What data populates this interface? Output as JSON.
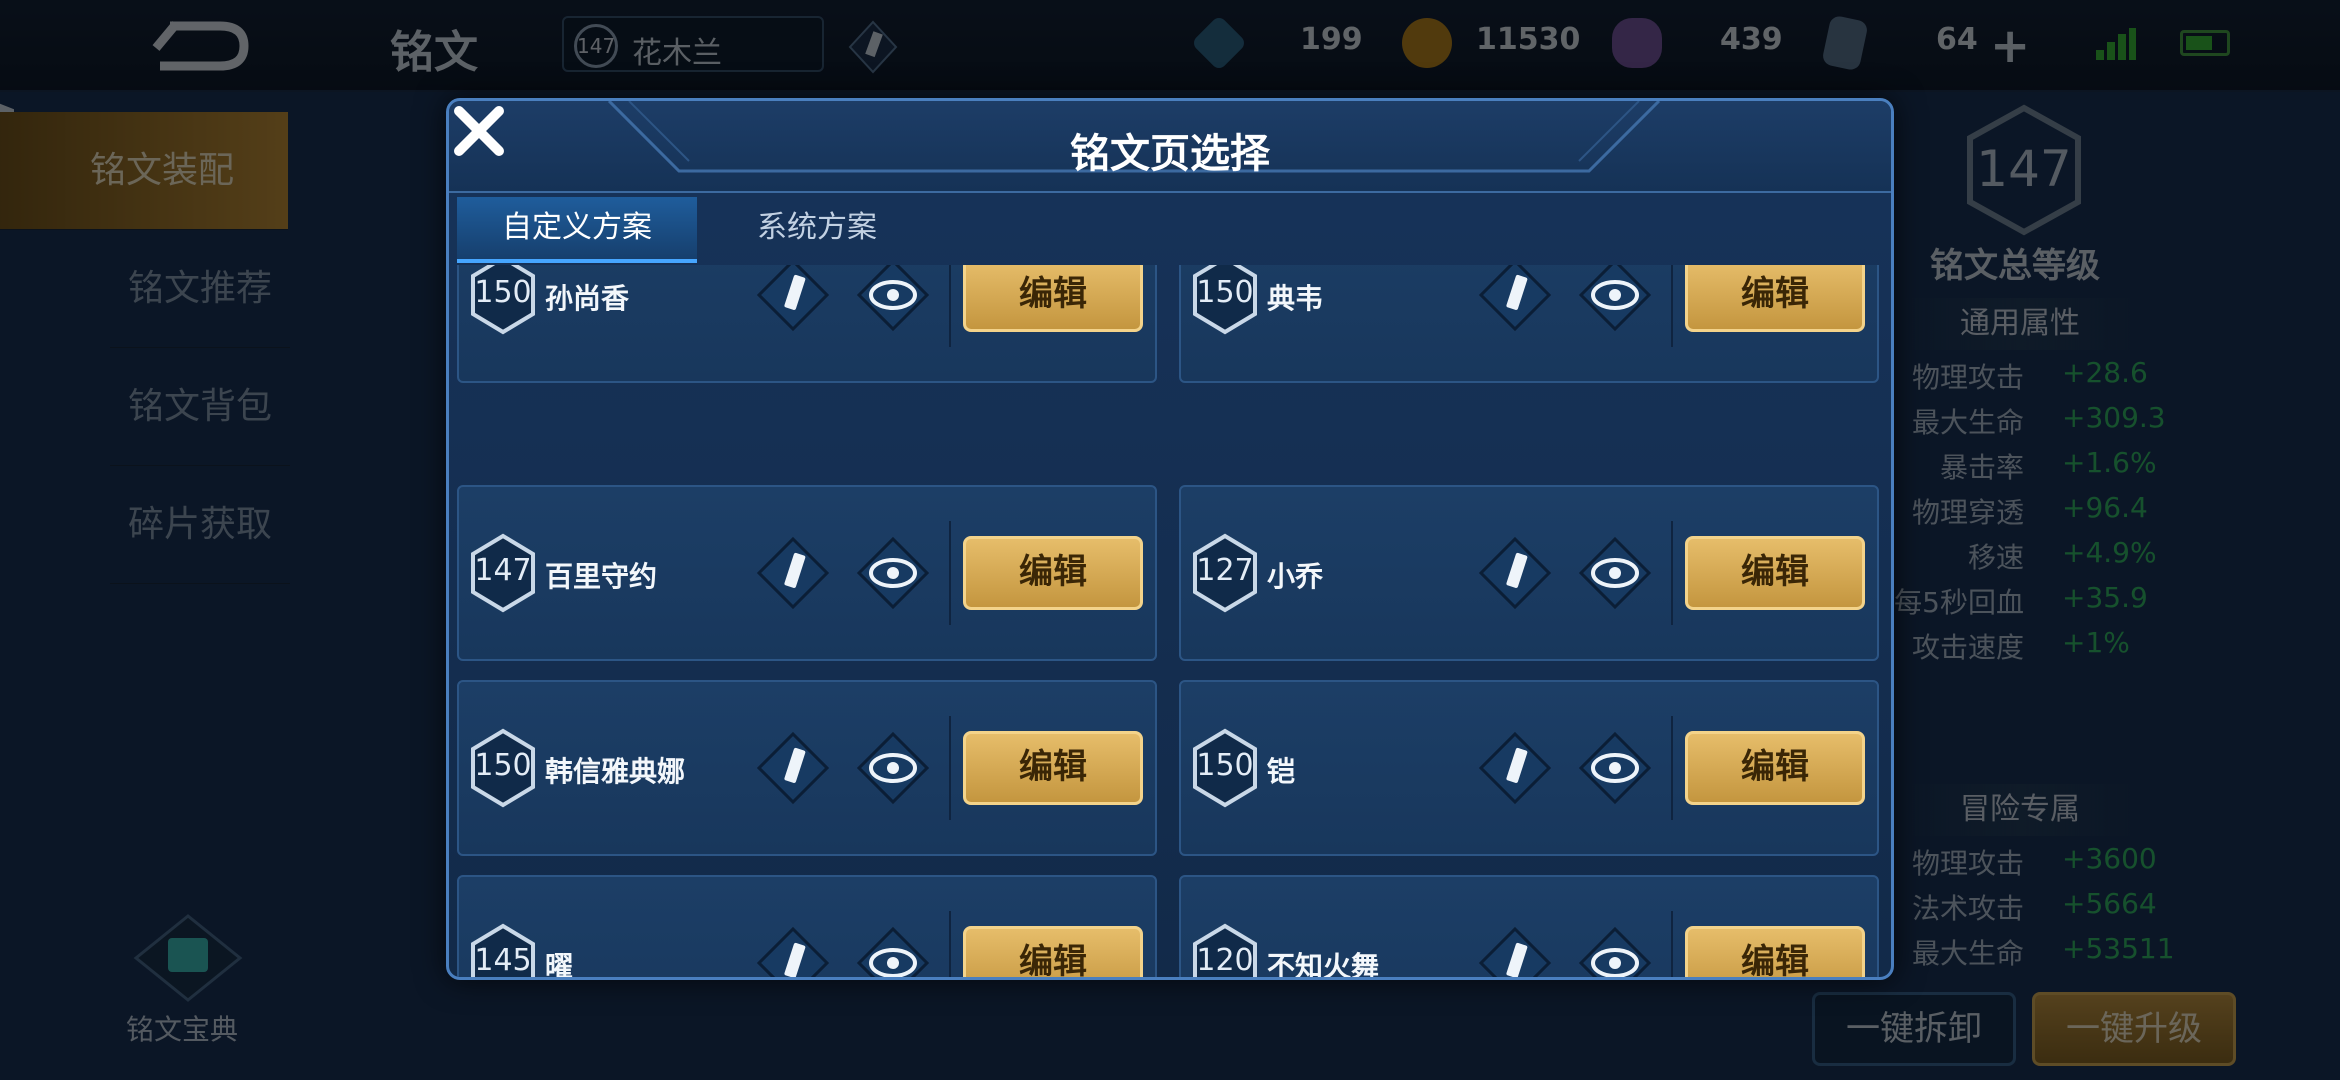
{
  "topbar": {
    "title": "铭文",
    "hero_level": "147",
    "hero_name": "花木兰",
    "resources": [
      {
        "icon": "diamond-icon",
        "value": "199"
      },
      {
        "icon": "gold-coin-icon",
        "value": "11530"
      },
      {
        "icon": "crystal-icon",
        "value": "439"
      },
      {
        "icon": "card-icon",
        "value": "64"
      }
    ]
  },
  "leftnav": {
    "items": [
      "铭文装配",
      "铭文推荐",
      "铭文背包",
      "碎片获取"
    ],
    "bible_label": "铭文宝典"
  },
  "right_panel": {
    "total_level": "147",
    "total_level_label": "铭文总等级",
    "general_title": "通用属性",
    "general_stats": [
      {
        "k": "物理攻击",
        "v": "+28.6"
      },
      {
        "k": "最大生命",
        "v": "+309.3"
      },
      {
        "k": "暴击率",
        "v": "+1.6%"
      },
      {
        "k": "物理穿透",
        "v": "+96.4"
      },
      {
        "k": "移速",
        "v": "+4.9%"
      },
      {
        "k": "每5秒回血",
        "v": "+35.9"
      },
      {
        "k": "攻击速度",
        "v": "+1%"
      }
    ],
    "adventure_title": "冒险专属",
    "adventure_stats": [
      {
        "k": "物理攻击",
        "v": "+3600"
      },
      {
        "k": "法术攻击",
        "v": "+5664"
      },
      {
        "k": "最大生命",
        "v": "+53511"
      }
    ],
    "unload_label": "一键拆卸",
    "upgrade_label": "一键升级"
  },
  "modal": {
    "title": "铭文页选择",
    "tabs": [
      "自定义方案",
      "系统方案"
    ],
    "edit_label": "编辑",
    "pages": [
      {
        "level": "150",
        "name": "孙尚香"
      },
      {
        "level": "150",
        "name": "典韦"
      },
      {
        "level": "147",
        "name": "百里守约"
      },
      {
        "level": "127",
        "name": "小乔"
      },
      {
        "level": "150",
        "name": "韩信雅典娜"
      },
      {
        "level": "150",
        "name": "铠"
      },
      {
        "level": "145",
        "name": "曜"
      },
      {
        "level": "120",
        "name": "不知火舞"
      }
    ]
  },
  "colors": {
    "accent_gold": "#e6bd6a",
    "stat_green": "#35c06a",
    "modal_border": "#4a7fbf"
  }
}
